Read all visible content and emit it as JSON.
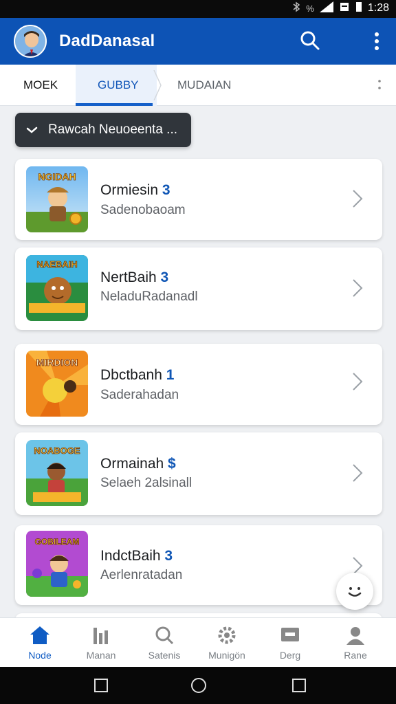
{
  "status_bar": {
    "time": "1:28",
    "battery_text": "%"
  },
  "app_bar": {
    "title": "DadDanasal"
  },
  "tabs": [
    {
      "label": "MOEK"
    },
    {
      "label": "GUBBY"
    },
    {
      "label": "MUDAIAN"
    }
  ],
  "filter_chip": {
    "label": "Rawcah Neuoeenta ..."
  },
  "items": [
    {
      "title": "Ormiesin",
      "num": "3",
      "subtitle": "Sadenobaoam",
      "thumb_text": "NGIDAH"
    },
    {
      "title": "NertBaih",
      "num": "3",
      "subtitle": "NeladuRadanadl",
      "thumb_text": "NAEBAIH"
    },
    {
      "title": "Dbctbanh",
      "num": "1",
      "subtitle": "Saderahadan",
      "thumb_text": "MIRDION"
    },
    {
      "title": "Ormainah",
      "num": "$",
      "subtitle": "Selaeh 2alsinall",
      "thumb_text": "NOABOGE"
    },
    {
      "title": "IndctBaih",
      "num": "3",
      "subtitle": "Aerlenratadan",
      "thumb_text": "GOBILEAM"
    }
  ],
  "bottom_nav": [
    {
      "label": "Node",
      "icon": "home-icon"
    },
    {
      "label": "Manan",
      "icon": "bar-chart-icon"
    },
    {
      "label": "Satenis",
      "icon": "search-icon"
    },
    {
      "label": "Munigön",
      "icon": "gear-icon"
    },
    {
      "label": "Derg",
      "icon": "message-icon"
    },
    {
      "label": "Rane",
      "icon": "person-icon"
    }
  ],
  "colors": {
    "primary": "#0d53b5",
    "accent": "#1560c9"
  }
}
